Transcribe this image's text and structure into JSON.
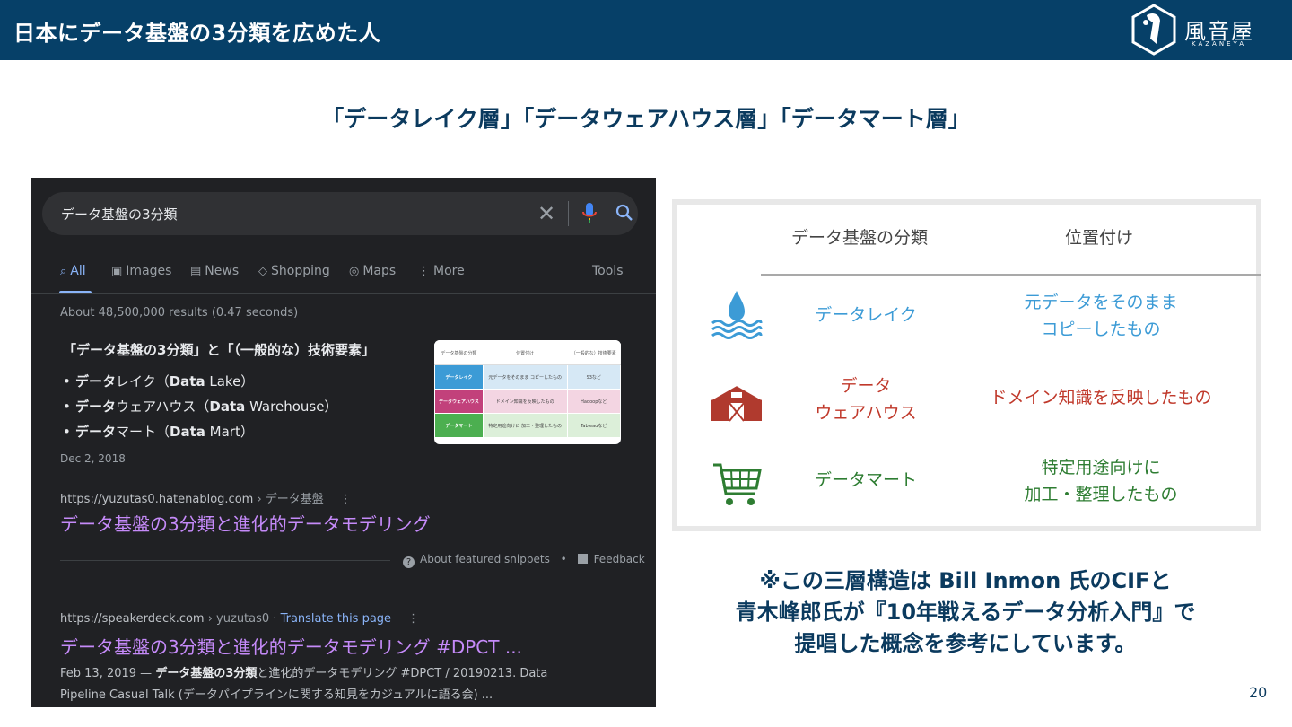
{
  "header": {
    "title": "日本にデータ基盤の3分類を広めた人",
    "logo_text": "風音屋",
    "logo_sub": "KAZANEYA"
  },
  "subtitle": "「データレイク層」「データウェアハウス層」「データマート層」",
  "google": {
    "query": "データ基盤の3分類",
    "tabs": [
      {
        "label": "All",
        "icon": "search-icon"
      },
      {
        "label": "Images",
        "icon": "image-icon"
      },
      {
        "label": "News",
        "icon": "news-icon"
      },
      {
        "label": "Shopping",
        "icon": "tag-icon"
      },
      {
        "label": "Maps",
        "icon": "pin-icon"
      },
      {
        "label": "More",
        "icon": "more-vert-icon"
      }
    ],
    "tools": "Tools",
    "stats": "About 48,500,000 results (0.47 seconds)",
    "snippet": {
      "title": "「データ基盤の3分類」と「（一般的な）技術要素」",
      "bullets": [
        {
          "bold": "データ",
          "rest": "レイク（",
          "bold2": "Data",
          "rest2": " Lake）"
        },
        {
          "bold": "データ",
          "rest": "ウェアハウス（",
          "bold2": "Data",
          "rest2": " Warehouse）"
        },
        {
          "bold": "データ",
          "rest": "マート（",
          "bold2": "Data",
          "rest2": " Mart）"
        }
      ],
      "date": "Dec 2, 2018",
      "thumb": {
        "headers": [
          "データ基盤の分類",
          "位置付け",
          "（一般的な）技術要素"
        ],
        "rows": [
          [
            "データレイク",
            "元データをそのまま コピーしたもの",
            "S3など"
          ],
          [
            "データウェアハウス",
            "ドメイン知識を反映したもの",
            "Hadoopなど"
          ],
          [
            "データマート",
            "特定用途向けに 加工・整理したもの",
            "Tableauなど"
          ]
        ]
      }
    },
    "result1": {
      "url": "https://yuzutas0.hatenablog.com",
      "path": " › データ基盤",
      "title": "データ基盤の3分類と進化的データモデリング"
    },
    "featured": {
      "about": "About featured snippets",
      "sep": "•",
      "feedback": "Feedback"
    },
    "result2": {
      "url": "https://speakerdeck.com",
      "path": " › yuzutas0",
      "sep": " · ",
      "translate": "Translate this page",
      "title": "データ基盤の3分類と進化的データモデリング #DPCT ...",
      "desc_prefix": "Feb 13, 2019 — ",
      "desc_bold": "データ基盤の3分類",
      "desc_rest": "と進化的データモデリング #DPCT / 20190213. Data",
      "desc_line2": "Pipeline Casual Talk (データパイプラインに関する知見をカジュアルに語る会) ..."
    }
  },
  "table": {
    "header_category": "データ基盤の分類",
    "header_position": "位置付け",
    "rows": [
      {
        "icon": "water-icon",
        "category_lines": [
          "データレイク"
        ],
        "position_lines": [
          "元データをそのまま",
          "コピーしたもの"
        ],
        "color": "#3c9bd6"
      },
      {
        "icon": "warehouse-icon",
        "category_lines": [
          "データ",
          "ウェアハウス"
        ],
        "position_lines": [
          "ドメイン知識を反映したもの"
        ],
        "color": "#c0392b"
      },
      {
        "icon": "cart-icon",
        "category_lines": [
          "データマート"
        ],
        "position_lines": [
          "特定用途向けに",
          "加工・整理したもの"
        ],
        "color": "#2e7d32"
      }
    ]
  },
  "note": {
    "line1": "※この三層構造は Bill Inmon 氏のCIFと",
    "line2": "青木峰郎氏が『10年戦えるデータ分析入門』で",
    "line3": "提唱した概念を参考にしています。"
  },
  "page_number": "20"
}
